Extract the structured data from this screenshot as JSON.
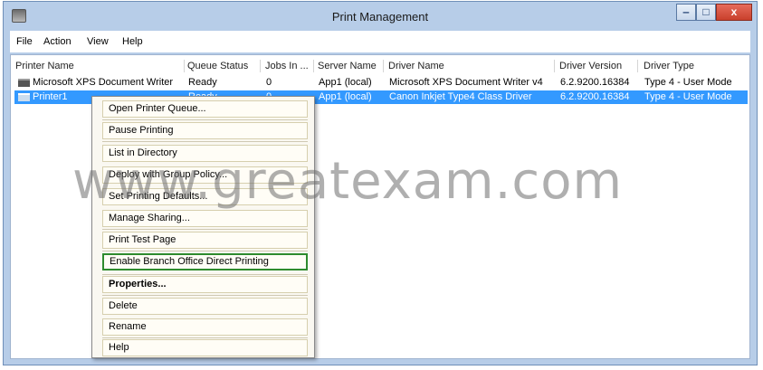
{
  "window": {
    "title": "Print Management",
    "controls": {
      "minimize": "‒",
      "maximize": "□",
      "close": "x"
    }
  },
  "menu": [
    "File",
    "Action",
    "View",
    "Help"
  ],
  "table": {
    "headers": [
      "Printer Name",
      "Queue Status",
      "Jobs In ...",
      "Server Name",
      "Driver Name",
      "Driver Version",
      "Driver Type"
    ],
    "rows": [
      [
        "Microsoft XPS Document Writer",
        "Ready",
        "0",
        "App1 (local)",
        "Microsoft XPS Document Writer v4",
        "6.2.9200.16384",
        "Type 4 - User Mode"
      ],
      [
        "Printer1",
        "Ready",
        "0",
        "App1 (local)",
        "Canon Inkjet Type4 Class Driver",
        "6.2.9200.16384",
        "Type 4 - User Mode"
      ]
    ],
    "selected_row": 1
  },
  "context_menu": {
    "items": [
      "Open Printer Queue...",
      "Pause Printing",
      "List in Directory",
      "Deploy with Group Policy...",
      "Set Printing Defaults...",
      "Manage Sharing...",
      "Print Test Page",
      "Enable Branch Office Direct Printing",
      "Properties...",
      "Delete",
      "Rename",
      "Help"
    ],
    "bold_item": "Properties...",
    "highlighted_item": "Enable Branch Office Direct Printing"
  },
  "watermark": "www.greatexam.com",
  "colors": {
    "selection": "#3399ff",
    "highlight_border": "#2e8b2e",
    "close_button": "#d9503c"
  }
}
